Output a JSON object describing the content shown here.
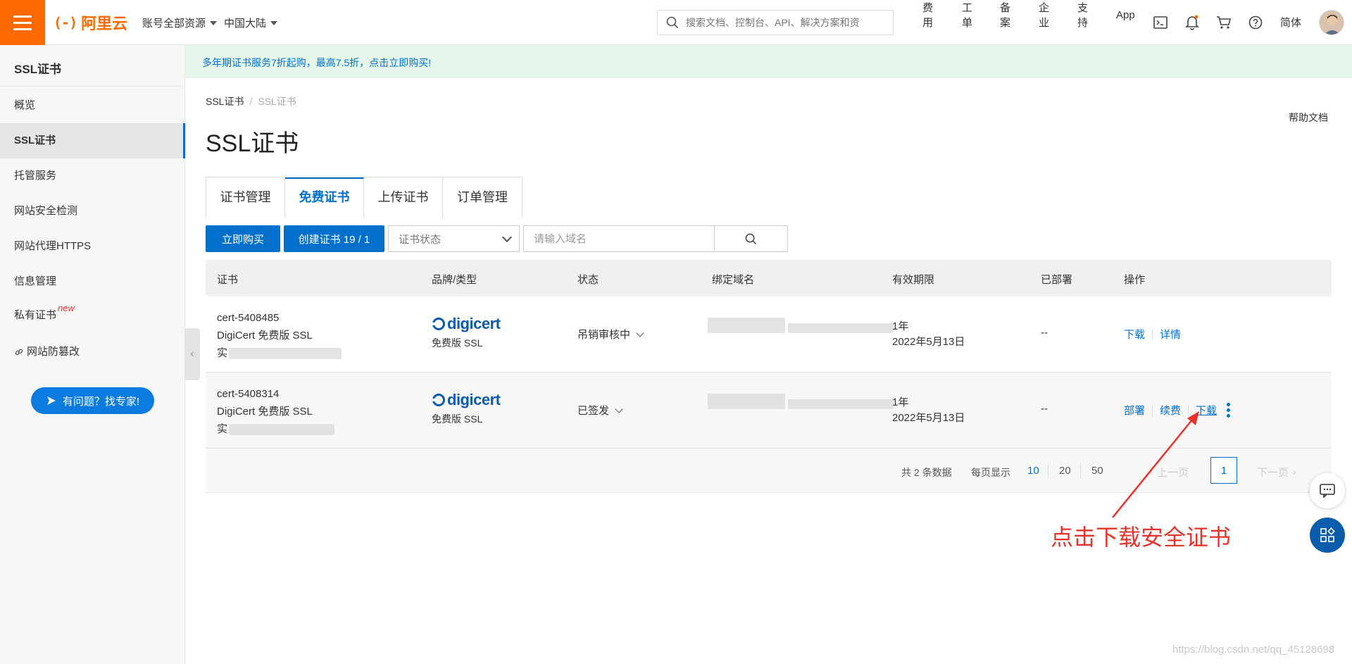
{
  "header": {
    "logo_text": "阿里云",
    "logo_mark": "(-)",
    "account_resource": "账号全部资源",
    "region": "中国大陆",
    "search_placeholder": "搜索文档、控制台、API、解决方案和资",
    "links": [
      "费用",
      "工单",
      "备案",
      "企业",
      "支持",
      "App"
    ],
    "language": "简体",
    "colors": {
      "brand": "#ff6a00",
      "accent": "#0070cc"
    },
    "icons": [
      "terminal-icon",
      "bell-icon",
      "cart-icon",
      "help-icon"
    ]
  },
  "sidebar": {
    "title": "SSL证书",
    "items": [
      {
        "label": "概览"
      },
      {
        "label": "SSL证书",
        "active": true
      },
      {
        "label": "托管服务"
      },
      {
        "label": "网站安全检测"
      },
      {
        "label": "网站代理HTTPS"
      },
      {
        "label": "信息管理"
      },
      {
        "label": "私有证书",
        "badge": "new"
      },
      {
        "label": "网站防篡改",
        "icon": "link-icon"
      }
    ],
    "help_button": "有问题？找专家!"
  },
  "banner": {
    "text": "多年期证书服务7折起购，最高7.5折，点击立即购买!"
  },
  "breadcrumb": [
    "SSL证书",
    "SSL证书"
  ],
  "help_doc": "帮助文档",
  "page_title": "SSL证书",
  "tabs": [
    {
      "label": "证书管理"
    },
    {
      "label": "免费证书",
      "active": true
    },
    {
      "label": "上传证书"
    },
    {
      "label": "订单管理"
    }
  ],
  "toolbar": {
    "buy_now": "立即购买",
    "create_cert": "创建证书 19 / 1",
    "status_select": "证书状态",
    "domain_placeholder": "请输入域名"
  },
  "table": {
    "headers": [
      "证书",
      "品牌/类型",
      "状态",
      "绑定域名",
      "有效期限",
      "已部署",
      "操作"
    ],
    "rows": [
      {
        "cert_id": "cert-5408485",
        "cert_name": "DigiCert 免费版 SSL",
        "cert_extra": "实",
        "brand": "digicert",
        "type": "免费版 SSL",
        "status": "吊销审核中",
        "validity": "1年",
        "expire": "2022年5月13日",
        "deployed": "--",
        "ops": [
          "下载",
          "详情"
        ]
      },
      {
        "cert_id": "cert-5408314",
        "cert_name": "DigiCert 免费版 SSL",
        "cert_extra": "实",
        "brand": "digicert",
        "type": "免费版 SSL",
        "status": "已签发",
        "validity": "1年",
        "expire": "2022年5月13日",
        "deployed": "--",
        "ops": [
          "部署",
          "续费",
          "下载"
        ]
      }
    ]
  },
  "pagination": {
    "total": "共 2 条数据",
    "per_page_label": "每页显示",
    "sizes": [
      "10",
      "20",
      "50"
    ],
    "prev": "上一页",
    "current": "1",
    "next": "下一页"
  },
  "annotation": "点击下载安全证书",
  "watermark": "https://blog.csdn.net/qq_45128698"
}
